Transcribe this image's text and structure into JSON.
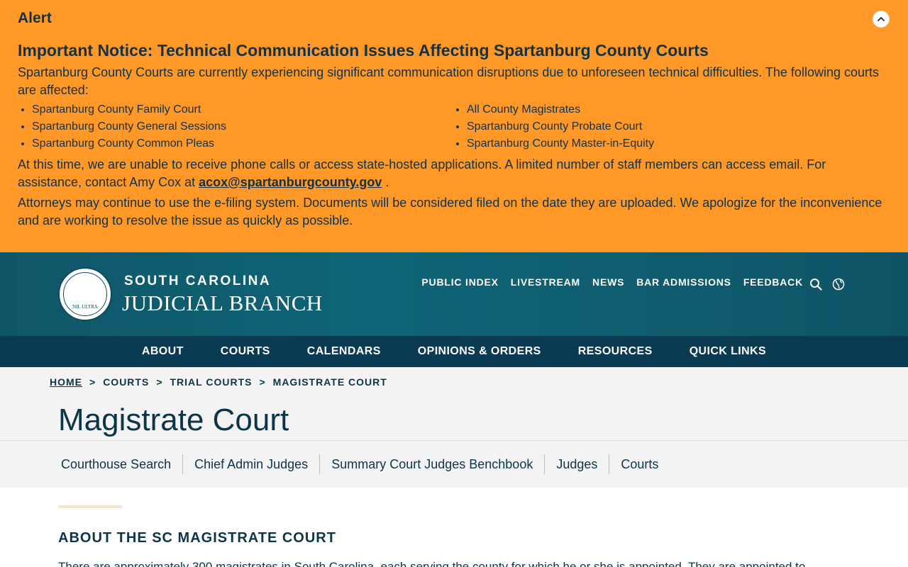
{
  "alert": {
    "label": "Alert",
    "heading": "Important Notice: Technical Communication Issues Affecting Spartanburg County Courts",
    "paragraph1": "Spartanburg County Courts are currently experiencing significant communication disruptions due to unforeseen technical difficulties. The following courts are affected:",
    "courts_left": [
      "Spartanburg County Family Court",
      "Spartanburg County General Sessions",
      "Spartanburg County Common Pleas"
    ],
    "courts_right": [
      "All County Magistrates",
      "Spartanburg County Probate Court",
      "Spartanburg County Master-in-Equity"
    ],
    "paragraph2_before": "At this time, we are unable to receive phone calls or access state-hosted applications. A limited number of staff members can access email. For assistance, contact Amy Cox at ",
    "email": "acox@spartanburgcounty.gov",
    "paragraph2_after": " .",
    "paragraph3": "Attorneys may continue to use the e-filing system. Documents will be considered filed on the date they are uploaded. We apologize for the inconvenience and are working to resolve the issue as quickly as possible.",
    "toggle_icon": "chevron-up-icon",
    "color": "#ff9826"
  },
  "header": {
    "brand_top": "SOUTH CAROLINA",
    "brand_main": "JUDICIAL BRANCH",
    "seal_text": "NIL ULTRA",
    "utility_links": [
      "PUBLIC INDEX",
      "LIVESTREAM",
      "NEWS",
      "BAR ADMISSIONS",
      "FEEDBACK"
    ],
    "icons": [
      "search-icon",
      "globe-icon"
    ]
  },
  "main_nav": [
    "ABOUT",
    "COURTS",
    "CALENDARS",
    "OPINIONS & ORDERS",
    "RESOURCES",
    "QUICK LINKS"
  ],
  "breadcrumb": {
    "items": [
      "HOME",
      "COURTS",
      "TRIAL COURTS",
      "MAGISTRATE COURT"
    ],
    "separator": ">"
  },
  "page_title": "Magistrate Court",
  "sub_nav": [
    "Courthouse Search",
    "Chief Admin Judges",
    "Summary Court Judges Benchbook",
    "Judges",
    "Courts"
  ],
  "content": {
    "section_title": "ABOUT THE SC MAGISTRATE COURT",
    "section_text": "There are approximately 300 magistrates in South Carolina, each serving the county for which he or she is appointed. They are appointed to"
  }
}
